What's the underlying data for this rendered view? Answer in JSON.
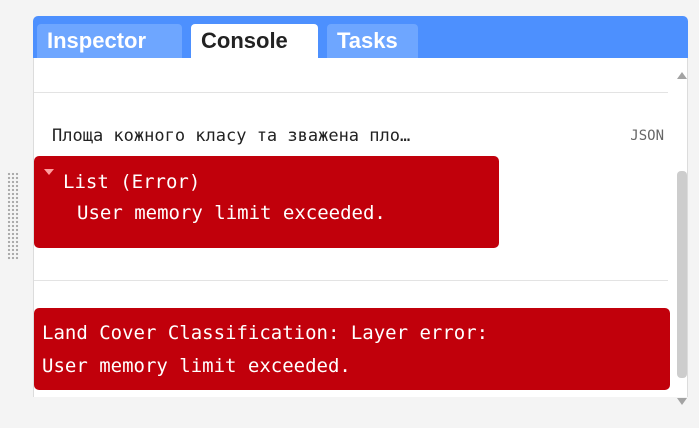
{
  "tabs": [
    {
      "label": "Inspector",
      "active": false
    },
    {
      "label": "Console",
      "active": true
    },
    {
      "label": "Tasks",
      "active": false
    }
  ],
  "console": {
    "result_label": "Площа кожного класу та зважена пло…",
    "json_link": "JSON",
    "list_error": {
      "title": "List (Error)",
      "message": "User memory limit exceeded."
    },
    "layer_error": {
      "line1": "Land Cover Classification: Layer error:",
      "line2": "User memory limit exceeded."
    }
  },
  "colors": {
    "tab_bar": "#4d90fe",
    "tab_inactive": "#6ea6ff",
    "error_background": "#c1000b",
    "error_text": "#ffffff"
  },
  "icons": {
    "expand_caret": "caret-down-icon",
    "scroll_up": "arrow-up-icon",
    "scroll_down": "arrow-down-icon",
    "resize_handle": "drag-handle-icon"
  }
}
